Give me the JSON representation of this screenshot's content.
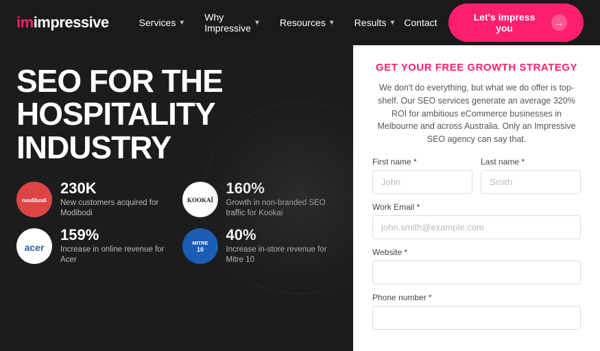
{
  "nav": {
    "logo": "impressive",
    "links": [
      {
        "label": "Services",
        "hasDropdown": true
      },
      {
        "label": "Why Impressive",
        "hasDropdown": true
      },
      {
        "label": "Resources",
        "hasDropdown": true
      },
      {
        "label": "Results",
        "hasDropdown": true
      }
    ],
    "contact_label": "Contact",
    "cta_label": "Let's impress you"
  },
  "hero": {
    "title_line1": "SEO FOR THE",
    "title_line2": "HOSPITALITY",
    "title_line3": "INDUSTRY"
  },
  "stats": [
    {
      "logo_name": "modibodi",
      "number": "230K",
      "desc_line1": "New customers acquired for",
      "desc_line2": "Modibodi"
    },
    {
      "logo_name": "kookai",
      "number": "160%",
      "desc_line1": "Growth in non-branded SEO",
      "desc_line2": "traffic for Kookai"
    },
    {
      "logo_name": "acer",
      "number": "159%",
      "desc_line1": "Increase in online revenue for",
      "desc_line2": "Acer"
    },
    {
      "logo_name": "mitre10",
      "number": "40%",
      "desc_line1": "Increase in-store revenue for",
      "desc_line2": "Mitre 10"
    }
  ],
  "form": {
    "title": "GET YOUR FREE GROWTH STRATEGY",
    "description": "We don't do everything, but what we do offer is top-shelf. Our SEO services generate an average 320% ROI for ambitious eCommerce businesses in Melbourne and across Australia. Only an Impressive SEO agency can say that.",
    "first_name_label": "First name *",
    "first_name_placeholder": "John",
    "last_name_label": "Last name *",
    "last_name_placeholder": "Smith",
    "email_label": "Work Email *",
    "email_placeholder": "john.smith@example.com",
    "website_label": "Website *",
    "website_placeholder": "",
    "phone_label": "Phone number *",
    "phone_placeholder": ""
  }
}
